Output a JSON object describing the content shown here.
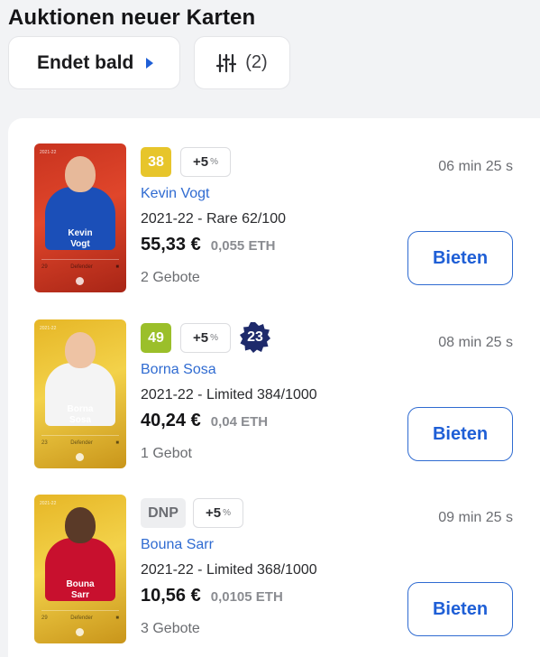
{
  "title": "Auktionen neuer Karten",
  "sort": {
    "label": "Endet bald"
  },
  "filter": {
    "count": "(2)"
  },
  "colors": {
    "accent": "#1f5fd6",
    "level_yellow": "#e7c52b",
    "level_lime": "#9bbf2a",
    "serial_navy": "#1e2a6b"
  },
  "auctions": [
    {
      "level": "38",
      "bonus": "+5",
      "bonus_unit": "%",
      "player": "Kevin Vogt",
      "edition": "2021-22 - Rare 62/100",
      "price_eur": "55,33 €",
      "price_eth": "0,055 ETH",
      "bids": "2 Gebote",
      "time_left": "06 min 25 s",
      "button": "Bieten",
      "card": {
        "first": "Kevin",
        "last": "Vogt",
        "season": "2021-22",
        "serial": "62/100",
        "age": "29",
        "position": "Defender",
        "style": "red",
        "kit": "#1b4fb8",
        "skin": "#e7b99a"
      }
    },
    {
      "level": "49",
      "bonus": "+5",
      "bonus_unit": "%",
      "serial_badge": "23",
      "player": "Borna Sosa",
      "edition": "2021-22 - Limited 384/1000",
      "price_eur": "40,24 €",
      "price_eth": "0,04 ETH",
      "bids": "1 Gebot",
      "time_left": "08 min 25 s",
      "button": "Bieten",
      "card": {
        "first": "Borna",
        "last": "Sosa",
        "season": "2021-22",
        "serial": "384/1000",
        "age": "23",
        "position": "Defender",
        "style": "gold",
        "kit": "#f4f4f4",
        "skin": "#eec3a4"
      }
    },
    {
      "level": "DNP",
      "bonus": "+5",
      "bonus_unit": "%",
      "player": "Bouna Sarr",
      "edition": "2021-22 - Limited 368/1000",
      "price_eur": "10,56 €",
      "price_eth": "0,0105 ETH",
      "bids": "3 Gebote",
      "time_left": "09 min 25 s",
      "button": "Bieten",
      "card": {
        "first": "Bouna",
        "last": "Sarr",
        "season": "2021-22",
        "serial": "368/1000",
        "age": "29",
        "position": "Defender",
        "style": "gold",
        "kit": "#c8102e",
        "skin": "#5a3a28"
      }
    }
  ]
}
